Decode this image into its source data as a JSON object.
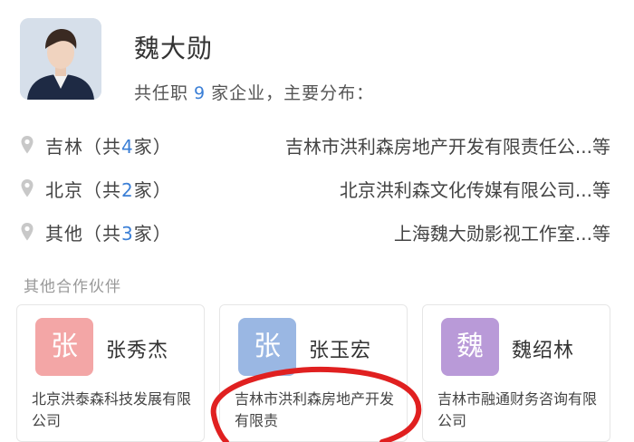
{
  "profile": {
    "name": "魏大勋",
    "summary_prefix": "共任职",
    "summary_count": "9",
    "summary_suffix": "家企业，主要分布："
  },
  "regions": [
    {
      "region": "吉林",
      "count": "4",
      "company": "吉林市洪利森房地产开发有限责任公...等"
    },
    {
      "region": "北京",
      "count": "2",
      "company": "北京洪利森文化传媒有限公司...等"
    },
    {
      "region": "其他",
      "count": "3",
      "company": "上海魏大勋影视工作室...等"
    }
  ],
  "region_text": {
    "open": "（共",
    "close": "家）"
  },
  "partners": {
    "title": "其他合作伙伴",
    "items": [
      {
        "badge": "张",
        "name": "张秀杰",
        "company": "北京洪泰森科技发展有限公司",
        "color": "#f3a6a6"
      },
      {
        "badge": "张",
        "name": "张玉宏",
        "company": "吉林市洪利森房地产开发有限责",
        "color": "#9ab7e3"
      },
      {
        "badge": "魏",
        "name": "魏绍林",
        "company": "吉林市融通财务咨询有限公司",
        "color": "#b99ad8"
      }
    ]
  },
  "colors": {
    "accent": "#3b7fd6",
    "annotation": "#e02020"
  },
  "icons": {
    "location": "location-pin-icon"
  }
}
